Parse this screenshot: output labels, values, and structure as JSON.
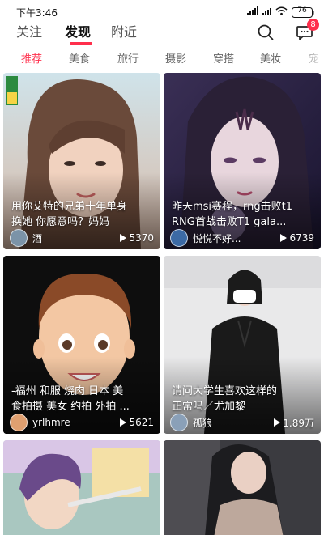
{
  "status_bar": {
    "time": "下午3:46",
    "battery": "76"
  },
  "top_nav": {
    "tabs": [
      {
        "label": "关注",
        "active": false
      },
      {
        "label": "发现",
        "active": true
      },
      {
        "label": "附近",
        "active": false
      }
    ],
    "accent_color": "#ff2f4c",
    "message_badge": "8"
  },
  "categories": [
    {
      "label": "推荐",
      "active": true
    },
    {
      "label": "美食",
      "active": false
    },
    {
      "label": "旅行",
      "active": false
    },
    {
      "label": "摄影",
      "active": false
    },
    {
      "label": "穿搭",
      "active": false
    },
    {
      "label": "美妆",
      "active": false
    },
    {
      "label": "宠",
      "active": false
    }
  ],
  "feed": [
    {
      "title_line1": "用你艾特的兄弟十年单身",
      "title_line2": "换她 你愿意吗？妈妈",
      "author": "酒",
      "plays": "5370"
    },
    {
      "title_line1": "昨天msi赛程，rng击败t1",
      "title_line2": "RNG首战击败T1 gala...",
      "author": "悦悦不好...",
      "plays": "6739"
    },
    {
      "title_line1": "-福州 和服 烧肉 日本 美",
      "title_line2": "食拍摄 美女 约拍 外拍 ...",
      "author": "yrlhmre",
      "plays": "5621"
    },
    {
      "title_line1": "请问大学生喜欢这样的",
      "title_line2": "正常吗／尤加黎",
      "author": "孤狼",
      "plays": "1.89万"
    },
    {
      "title_line1": "",
      "title_line2": "",
      "author": "",
      "plays": ""
    },
    {
      "title_line1": "",
      "title_line2": "",
      "author": "",
      "plays": ""
    }
  ]
}
